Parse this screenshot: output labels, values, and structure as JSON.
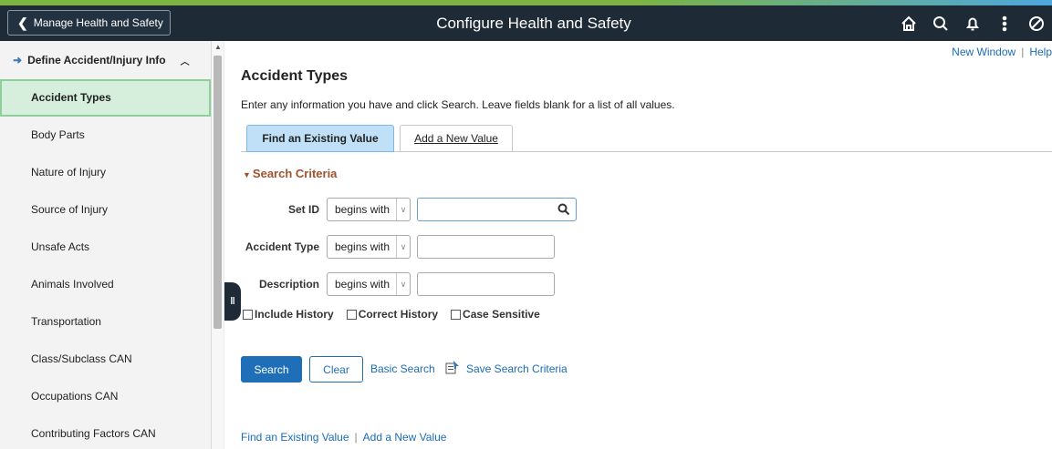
{
  "header": {
    "back_label": "Manage Health and Safety",
    "title": "Configure Health and Safety",
    "icons": [
      "home-icon",
      "search-icon",
      "notification-icon",
      "more-actions-icon",
      "navbar-icon"
    ]
  },
  "sidebar": {
    "group_label": "Define Accident/Injury Info",
    "items": [
      {
        "label": "Accident Types",
        "active": true
      },
      {
        "label": "Body Parts"
      },
      {
        "label": "Nature of Injury"
      },
      {
        "label": "Source of Injury"
      },
      {
        "label": "Unsafe Acts"
      },
      {
        "label": "Animals Involved"
      },
      {
        "label": "Transportation"
      },
      {
        "label": "Class/Subclass CAN"
      },
      {
        "label": "Occupations CAN"
      },
      {
        "label": "Contributing Factors CAN"
      }
    ]
  },
  "top_links": {
    "new_window": "New Window",
    "help": "Help"
  },
  "page": {
    "title": "Accident Types",
    "instructions": "Enter any information you have and click Search. Leave fields blank for a list of all values."
  },
  "tabs": {
    "find": "Find an Existing Value",
    "add": "Add a New Value"
  },
  "search": {
    "section_title": "Search Criteria",
    "fields": [
      {
        "label": "Set ID",
        "operator": "begins with",
        "value": ""
      },
      {
        "label": "Accident Type",
        "operator": "begins with",
        "value": ""
      },
      {
        "label": "Description",
        "operator": "begins with",
        "value": ""
      }
    ],
    "checkboxes": {
      "include_history": "Include History",
      "correct_history": "Correct History",
      "case_sensitive": "Case Sensitive"
    },
    "buttons": {
      "search": "Search",
      "clear": "Clear",
      "basic_search": "Basic Search",
      "save_criteria": "Save Search Criteria"
    }
  },
  "bottom_links": {
    "find": "Find an Existing Value",
    "add": "Add a New Value"
  },
  "colors": {
    "header_bg": "#1e2a36",
    "active_tab": "#bfe0f7",
    "active_nav": "#d6efdc",
    "primary_button": "#1f6fb8",
    "section_title": "#a0522d"
  }
}
